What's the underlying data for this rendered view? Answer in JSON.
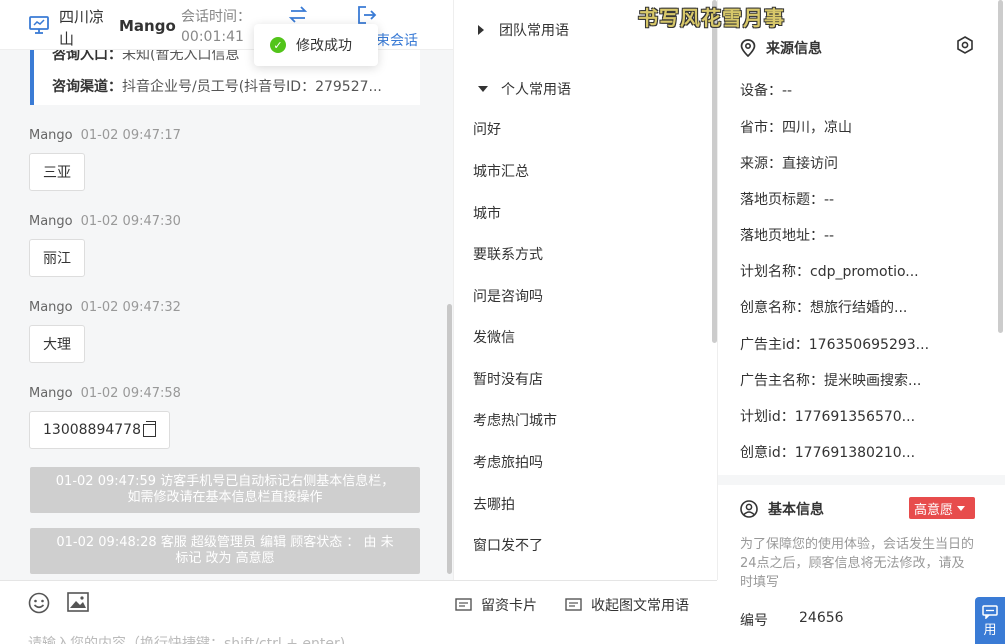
{
  "header": {
    "visitor_name": "四川凉山",
    "agent_name": "Mango",
    "session_time_label": "会话时间：",
    "session_time": "00:01:41",
    "end_session_label": "束会话"
  },
  "toast": {
    "text": "修改成功"
  },
  "info_card": {
    "entry_label": "咨询入口：",
    "entry_value": "未知(暂无入口信息",
    "channel_label": "咨询渠道：",
    "channel_value": "抖音企业号/员工号(抖音号ID：279527..."
  },
  "messages": [
    {
      "sender": "Mango",
      "time": "01-02 09:47:17",
      "text": "三亚"
    },
    {
      "sender": "Mango",
      "time": "01-02 09:47:30",
      "text": "丽江"
    },
    {
      "sender": "Mango",
      "time": "01-02 09:47:32",
      "text": "大理"
    },
    {
      "sender": "Mango",
      "time": "01-02 09:47:58",
      "text": "13008894778"
    }
  ],
  "system_notes": [
    {
      "text": "01-02 09:47:59 访客手机号已自动标记右侧基本信息栏，如需修改请在基本信息栏直接操作"
    },
    {
      "text": "01-02 09:48:28 客服 超级管理员 编辑 顾客状态 ： 由 未标记 改为 高意愿"
    }
  ],
  "input": {
    "placeholder": "请输入您的内容（换行快捷键：shift/ctrl + enter)",
    "card_label": "留资卡片",
    "collapse_label": "收起图文常用语"
  },
  "phrases": {
    "team_group": "团队常用语",
    "personal_group": "个人常用语",
    "items": [
      "问好",
      "城市汇总",
      "城市",
      "要联系方式",
      "问是咨询吗",
      "发微信",
      "暂时没有店",
      "考虑热门城市",
      "考虑旅拍吗",
      "去哪拍",
      "窗口发不了"
    ]
  },
  "watermark": "书写风花雪月事",
  "source_info": {
    "title": "来源信息",
    "fields": [
      "设备：--",
      "省市：四川，凉山",
      "来源：直接访问",
      "落地页标题：--",
      "落地页地址：--",
      "计划名称：cdp_promotio...",
      "创意名称：想旅行结婚的...",
      "广告主id：176350695293...",
      "广告主名称：提米映画搜索...",
      "计划id：177691356570...",
      "创意id：177691380210..."
    ]
  },
  "basic_info": {
    "title": "基本信息",
    "intent_label": "高意愿",
    "intent_color": "#e74c4c",
    "notice": "为了保障您的使用体验，会话发生当日的24点之后，顾客信息将无法修改，请及时填写",
    "id_label": "编号",
    "id_value": "24656"
  },
  "float_button": {
    "label": "用"
  },
  "colors": {
    "accent": "#3a7bd5",
    "success": "#52c41a",
    "danger": "#e74c4c"
  }
}
